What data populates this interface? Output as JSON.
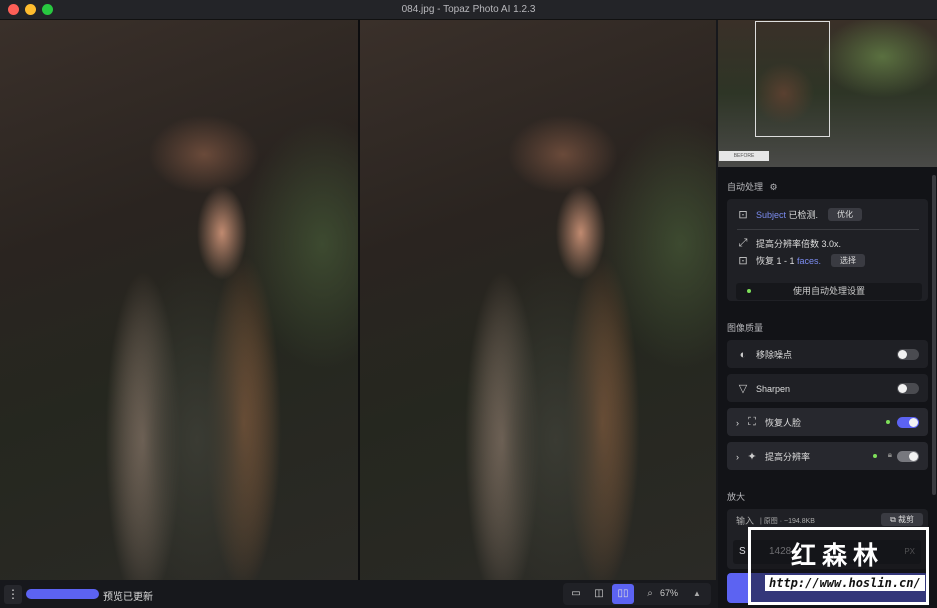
{
  "window": {
    "title": "084.jpg - Topaz Photo AI 1.2.3"
  },
  "colors": {
    "accent": "#5c63f2",
    "status_dot": "#7ee05a",
    "panel_bg": "#121317"
  },
  "navigator": {
    "before_label": "BEFORE"
  },
  "autopilot": {
    "heading": "自动处理",
    "subject_word": "Subject",
    "subject_suffix": " 已检测.",
    "refine_button": "优化",
    "upscale_text": "提高分辨率倍数 3.0x.",
    "faces_prefix": "恢复 1 - 1 ",
    "faces_word": "faces.",
    "select_button": "选择",
    "apply_button": "使用自动处理设置"
  },
  "quality": {
    "heading": "图像质量",
    "filters": [
      {
        "label": "移除噪点",
        "icon": "denoise-icon",
        "enabled": false
      },
      {
        "label": "Sharpen",
        "icon": "sharpen-icon",
        "enabled": false
      },
      {
        "label": "恢复人脸",
        "icon": "face-recovery-icon",
        "enabled": true
      },
      {
        "label": "提高分辨率",
        "icon": "upscale-icon",
        "enabled": true
      }
    ]
  },
  "enlarge": {
    "heading": "放大",
    "input_label": "输入",
    "info": "| 原图 · ~194.8KB",
    "crop_button": "裁剪",
    "size_prefix": "S",
    "width_value": "1428",
    "unit": "PX"
  },
  "bottombar": {
    "status": "预览已更新",
    "zoom": "67%",
    "view_mode": "side-by-side"
  },
  "watermark": {
    "cn": "红森林",
    "url": "http://www.hoslin.cn/"
  }
}
